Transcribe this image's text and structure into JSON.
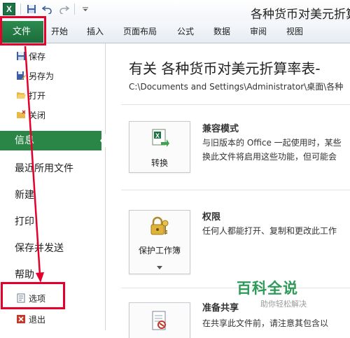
{
  "title_bar": {
    "document_title": "各种货币对美元折算"
  },
  "ribbon": {
    "file_tab": "文件",
    "tabs": [
      "开始",
      "插入",
      "页面布局",
      "公式",
      "数据",
      "审阅",
      "视图"
    ]
  },
  "backstage_menu": {
    "small_items": [
      "保存",
      "另存为",
      "打开",
      "关闭"
    ],
    "selected": "信息",
    "items": [
      "最近所用文件",
      "新建",
      "打印",
      "保存并发送",
      "帮助"
    ],
    "options": "选项",
    "exit": "退出"
  },
  "info_panel": {
    "title": "有关 各种货币对美元折算率表-",
    "path": "C:\\Documents and Settings\\Administrator\\桌面\\各种",
    "sections": [
      {
        "button_label": "转换",
        "heading": "兼容模式",
        "lines": [
          "与旧版本的 Office 一起使用时，某些",
          "换此文件将启用这些功能，但可能会"
        ]
      },
      {
        "button_label": "保护工作簿",
        "heading": "权限",
        "lines": [
          "任何人都能打开、复制和更改此工作"
        ]
      },
      {
        "button_label": "",
        "heading": "准备共享",
        "lines": [
          "在共享此文件前，请注意其包含以"
        ]
      }
    ]
  },
  "watermark": {
    "title": "百科全说",
    "subtitle": "助你轻松解决"
  },
  "colors": {
    "file_tab": "#1e7145",
    "selected_item": "#2a8647",
    "highlight": "#e4002b"
  }
}
